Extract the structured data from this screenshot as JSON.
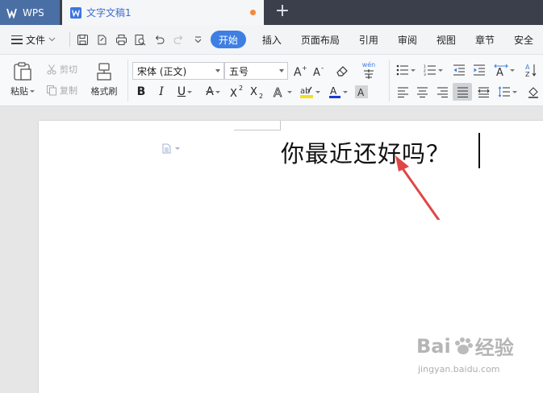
{
  "app": {
    "name": "WPS"
  },
  "tabs": [
    {
      "label": "文字文稿1",
      "unsaved": true
    }
  ],
  "menu": {
    "file_label": "文件",
    "items": [
      "开始",
      "插入",
      "页面布局",
      "引用",
      "审阅",
      "视图",
      "章节",
      "安全"
    ],
    "active": "开始"
  },
  "ribbon": {
    "paste_label": "粘贴",
    "cut_label": "剪切",
    "copy_label": "复制",
    "format_painter_label": "格式刷",
    "font_name": "宋体 (正文)",
    "font_size": "五号",
    "pinyin_label": "wén"
  },
  "document": {
    "text": "你最近还好吗？"
  },
  "watermark": {
    "brand": "Bai",
    "suffix": "经验",
    "url": "jingyan.baidu.com"
  },
  "colors": {
    "accent": "#3f7fe3",
    "arrow": "#e04646",
    "highlight": "#f2e21c",
    "font_color": "#1a3bd6"
  }
}
